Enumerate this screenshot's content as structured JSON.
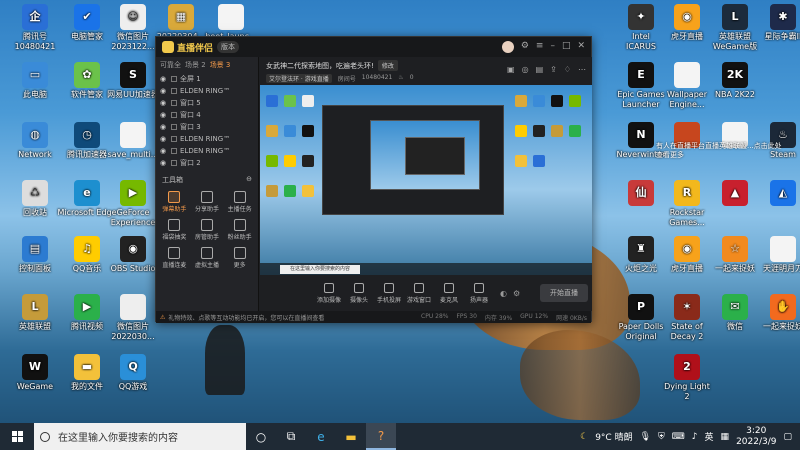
{
  "desktop": {
    "icons": [
      {
        "label": "腾讯号\n10480421",
        "color": "#2a6fd6",
        "glyph": "企"
      },
      {
        "label": "电脑管家",
        "color": "#1a73e8",
        "glyph": "✔"
      },
      {
        "label": "微信图片\n2023122...",
        "color": "#eee",
        "glyph": "☺"
      },
      {
        "label": "20220304...",
        "color": "#d9a93b",
        "glyph": "▦"
      },
      {
        "label": "boot_launc...",
        "color": "#f4f4f4",
        "glyph": ""
      },
      {
        "label": "此电脑",
        "color": "#3a8bd8",
        "glyph": "▭"
      },
      {
        "label": "软件管家",
        "color": "#6bc24a",
        "glyph": "✿"
      },
      {
        "label": "网易UU加速器",
        "color": "#111",
        "glyph": "S"
      },
      {
        "label": "Network",
        "color": "#3a8bd8",
        "glyph": "◍"
      },
      {
        "label": "腾讯加速器",
        "color": "#0f4a7a",
        "glyph": "◷"
      },
      {
        "label": "save_multi...",
        "color": "#f4f4f4",
        "glyph": ""
      },
      {
        "label": "回收站",
        "color": "#ddd",
        "glyph": "♺"
      },
      {
        "label": "Microsoft Edge",
        "color": "#1d8fcf",
        "glyph": "e"
      },
      {
        "label": "GeForce Experience",
        "color": "#76b900",
        "glyph": "▶"
      },
      {
        "label": "控制面板",
        "color": "#2c7bd1",
        "glyph": "▤"
      },
      {
        "label": "QQ音乐",
        "color": "#ffcc00",
        "glyph": "♫"
      },
      {
        "label": "OBS Studio",
        "color": "#222",
        "glyph": "◉"
      },
      {
        "label": "英雄联盟",
        "color": "#c59b3a",
        "glyph": "L"
      },
      {
        "label": "腾讯视频",
        "color": "#2bb04a",
        "glyph": "▶"
      },
      {
        "label": "微信图片\n2022030...",
        "color": "#eee",
        "glyph": ""
      },
      {
        "label": "WeGame",
        "color": "#111",
        "glyph": "W"
      },
      {
        "label": "我的文件",
        "color": "#f3c13a",
        "glyph": "▬"
      },
      {
        "label": "QQ游戏",
        "color": "#2a8fd8",
        "glyph": "Q"
      },
      {
        "label": "Intel\nICARUS",
        "color": "#333",
        "glyph": "✦"
      },
      {
        "label": "虎牙直播",
        "color": "#f7a21b",
        "glyph": "◉"
      },
      {
        "label": "英雄联盟\nWeGame版",
        "color": "#1c2b3c",
        "glyph": "L"
      },
      {
        "label": "星际争霸II",
        "color": "#1e2a4a",
        "glyph": "✱"
      },
      {
        "label": "Epic Games\nLauncher",
        "color": "#111",
        "glyph": "E"
      },
      {
        "label": "Wallpaper\nEngine...",
        "color": "#f4f4f4",
        "glyph": ""
      },
      {
        "label": "NBA 2K22",
        "color": "#111",
        "glyph": "2K"
      },
      {
        "label": "Neverwinter",
        "color": "#111",
        "glyph": "N"
      },
      {
        "label": "",
        "color": "#c7461e",
        "glyph": ""
      },
      {
        "label": "",
        "color": "#f4f4f4",
        "glyph": ""
      },
      {
        "label": "Steam",
        "color": "#1b2838",
        "glyph": "♨"
      },
      {
        "label": "",
        "color": "#c83a3a",
        "glyph": "仙"
      },
      {
        "label": "Rockstar\nGames...",
        "color": "#f2b81d",
        "glyph": "R"
      },
      {
        "label": "",
        "color": "#c8202e",
        "glyph": "▲"
      },
      {
        "label": "",
        "color": "#1a73e8",
        "glyph": "◭"
      },
      {
        "label": "火炬之光",
        "color": "#222",
        "glyph": "♜"
      },
      {
        "label": "虎牙直播",
        "color": "#f7a21b",
        "glyph": "◉"
      },
      {
        "label": "一起来捉妖",
        "color": "#f28a1e",
        "glyph": "☆"
      },
      {
        "label": "天涯明月刀",
        "color": "#f4f4f4",
        "glyph": ""
      },
      {
        "label": "Paper Dolls\nOriginal",
        "color": "#111",
        "glyph": "P"
      },
      {
        "label": "State of\nDecay 2",
        "color": "#8a2a1a",
        "glyph": "✶"
      },
      {
        "label": "微信",
        "color": "#2bb04a",
        "glyph": "✉"
      },
      {
        "label": "一起来捉妖",
        "color": "#f26a1e",
        "glyph": "✋"
      },
      {
        "label": "Dying Light\n2",
        "color": "#b0101a",
        "glyph": "2"
      }
    ],
    "notice_text": "有人在直播平台直播英雄联盟...点击此处查看更多"
  },
  "app": {
    "name": "直播伴侣",
    "version": "版本",
    "sidebar": {
      "tabs": [
        "可靠全",
        "场景 2",
        "场景 3"
      ],
      "active_tab": 2,
      "scenes": [
        "全屏 1",
        "ELDEN RING™",
        "窗口 5",
        "窗口 4",
        "窗口 3",
        "ELDEN RING™",
        "ELDEN RING™",
        "窗口 2"
      ],
      "tools_title": "工具箱",
      "tools": [
        "弹幕助手",
        "分享助手",
        "主播任务",
        "福袋抽奖",
        "房管助手",
        "粉丝助手",
        "直播连麦",
        "虚拟主播",
        "更多"
      ]
    },
    "title": "女武神二代探索地图，吃遍老头环!",
    "edit_button": "修改",
    "category": "艾尔登法环 · 游戏直播",
    "room_id": "10480421",
    "room_label": "房间号",
    "viewers": "0",
    "preview_search": "在这里输入你要搜索的内容",
    "bottom_tools": [
      "添加摄像",
      "摄像头",
      "手机投屏",
      "游戏窗口",
      "麦克风",
      "扬声器"
    ],
    "go_live": "开始直播",
    "status_warn": "礼物特效、点歌等互动功能均已开启，您可以在直播间查看",
    "stats": [
      "CPU 28%",
      "FPS 30",
      "内存 39%",
      "GPU 12%",
      "网速 0KB/s"
    ]
  },
  "taskbar": {
    "search_placeholder": "在这里输入你要搜索的内容",
    "weather": "9°C 晴朗",
    "ime": "英",
    "time": "3:20",
    "date": "2022/3/9"
  }
}
